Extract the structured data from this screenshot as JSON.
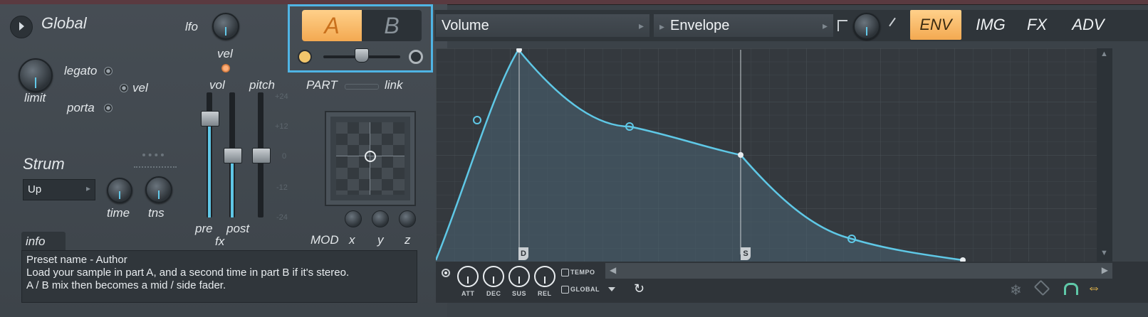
{
  "global": {
    "title": "Global",
    "lfo": "lfo",
    "vel_top": "vel",
    "limit": "limit",
    "legato": "legato",
    "vel": "vel",
    "porta": "porta"
  },
  "strum": {
    "title": "Strum",
    "mode": "Up",
    "time": "time",
    "tns": "tns"
  },
  "mixer": {
    "vol": "vol",
    "pitch": "pitch",
    "pre": "pre",
    "post": "post",
    "fx": "fx",
    "scale": [
      "+24",
      "+12",
      "0",
      "-12",
      "-24"
    ]
  },
  "ab": {
    "a": "A",
    "b": "B",
    "part": "PART",
    "link": "link"
  },
  "mod": {
    "label": "MOD",
    "x": "x",
    "y": "y",
    "z": "z"
  },
  "info": {
    "tab": "info",
    "lines": [
      "Preset name - Author",
      "Load your sample in part A, and a second time in part B if it's stereo.",
      "A / B mix then becomes a mid / side fader."
    ]
  },
  "header": {
    "target": "Volume",
    "type": "Envelope"
  },
  "tabs": [
    {
      "label": "ENV",
      "active": true
    },
    {
      "label": "IMG",
      "active": false
    },
    {
      "label": "FX",
      "active": false
    },
    {
      "label": "ADV",
      "active": false
    }
  ],
  "envelope": {
    "markers": {
      "decay": "D",
      "sustain": "S"
    },
    "colors": {
      "curve": "#5fc8e6",
      "fill": "#4a6472",
      "tab_active": "#f3a951",
      "highlight": "#4fb4e4"
    }
  },
  "bottom": {
    "knobs": [
      "ATT",
      "DEC",
      "SUS",
      "REL"
    ],
    "tempo": "TEMPO",
    "global": "GLOBAL"
  },
  "icons": [
    "play-icon",
    "reset-icon",
    "freeze-icon",
    "tag-icon",
    "magnet-icon",
    "swap-icon"
  ]
}
